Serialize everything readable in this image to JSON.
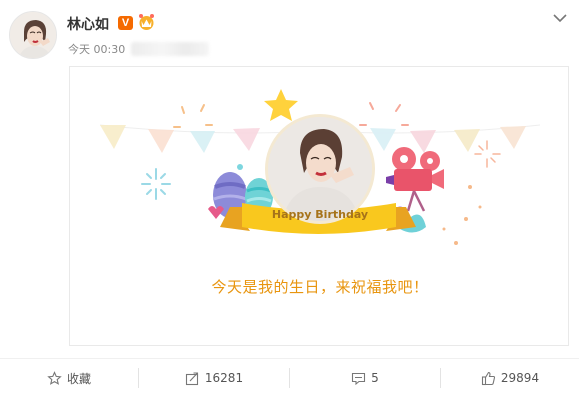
{
  "user": {
    "name": "林心如",
    "verified_icon": "verified-v-icon",
    "vip_icon": "crown-icon",
    "post_time": "今天 00:30"
  },
  "menu": {
    "icon": "chevron-down-icon"
  },
  "card": {
    "banner_text": "Happy Birthday",
    "caption": "今天是我的生日，来祝福我吧！"
  },
  "actions": {
    "favorite": {
      "label": "收藏",
      "icon": "star-outline-icon"
    },
    "repost": {
      "count": "16281",
      "icon": "share-icon"
    },
    "comment": {
      "count": "5",
      "icon": "comment-icon"
    },
    "like": {
      "count": "29894",
      "icon": "thumbs-up-icon"
    }
  },
  "colors": {
    "accent_orange": "#f56a00",
    "caption_gold": "#e8950f",
    "ribbon_yellow": "#f9c81e"
  }
}
